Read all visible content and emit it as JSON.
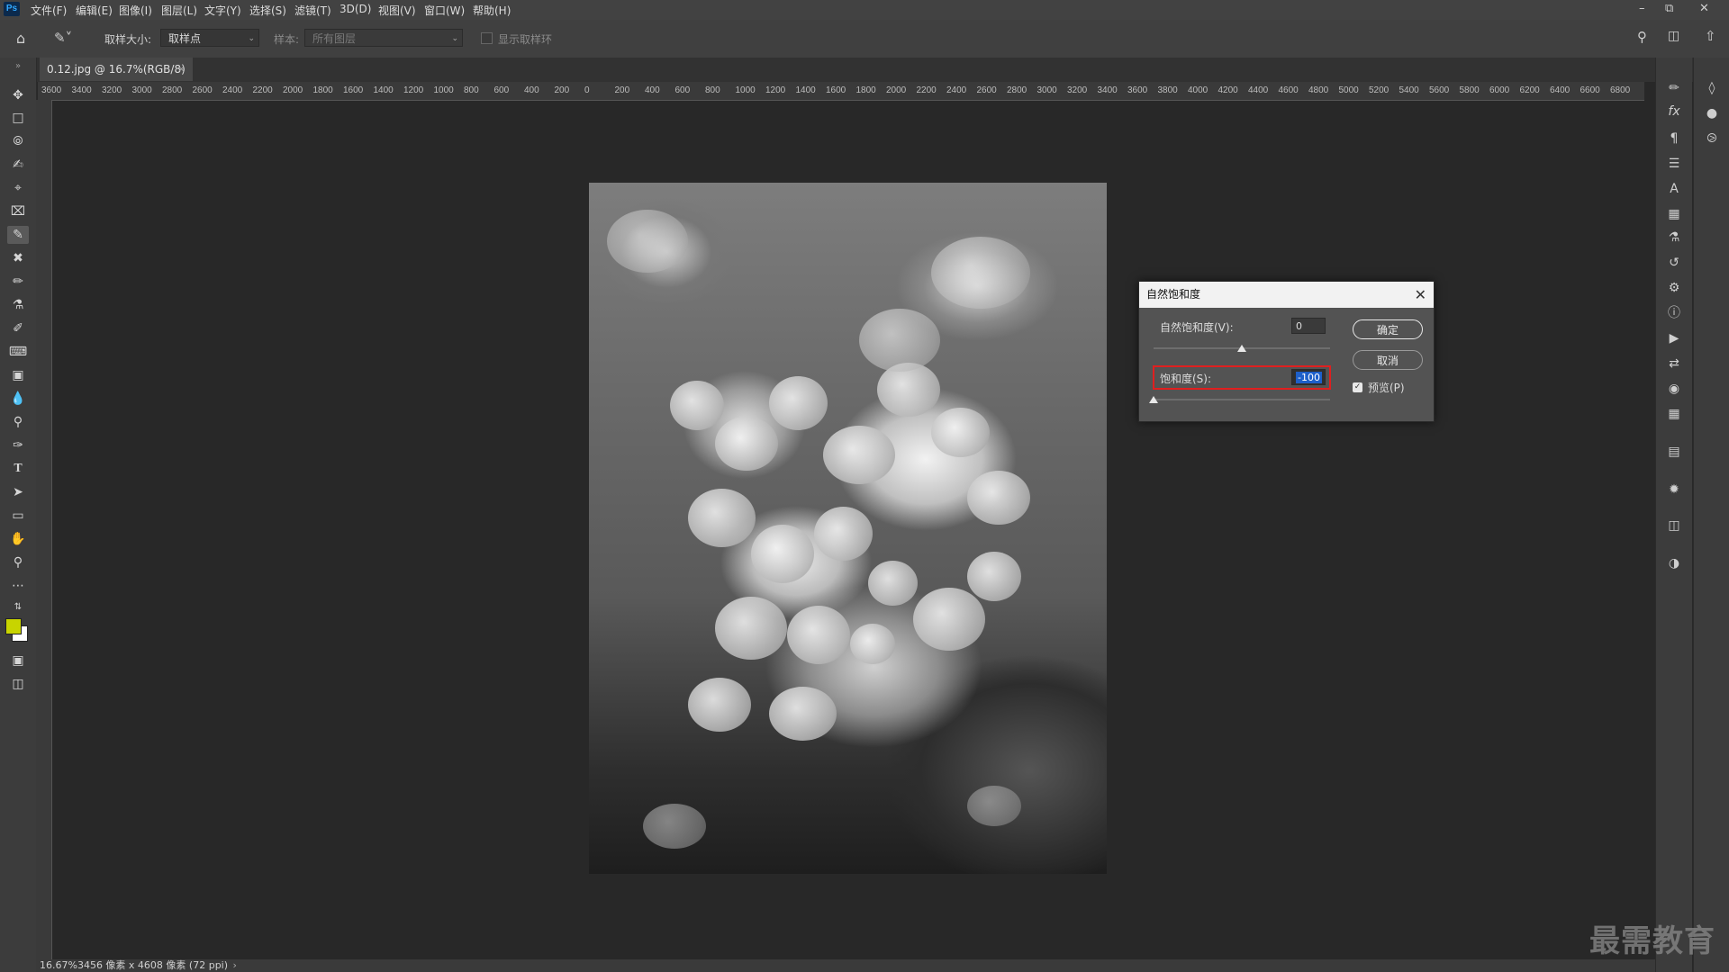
{
  "app": {
    "logo": "Ps"
  },
  "menu": [
    "文件(F)",
    "编辑(E)",
    "图像(I)",
    "图层(L)",
    "文字(Y)",
    "选择(S)",
    "滤镜(T)",
    "3D(D)",
    "视图(V)",
    "窗口(W)",
    "帮助(H)"
  ],
  "options": {
    "sample_size_label": "取样大小:",
    "sample_size_value": "取样点",
    "sample_label": "样本:",
    "sample_value": "所有图层",
    "show_ring_label": "显示取样环"
  },
  "document": {
    "tab_title": "0.12.jpg @ 16.7%(RGB/8)",
    "close": "×"
  },
  "ruler_top": [
    "3600",
    "3400",
    "3200",
    "3000",
    "2800",
    "2600",
    "2400",
    "2200",
    "2000",
    "1800",
    "1600",
    "1400",
    "1200",
    "1000",
    "800",
    "600",
    "400",
    "200",
    "0",
    "200",
    "400",
    "600",
    "800",
    "1000",
    "1200",
    "1400",
    "1600",
    "1800",
    "2000",
    "2200",
    "2400",
    "2600",
    "2800",
    "3000",
    "3200",
    "3400",
    "3600",
    "3800",
    "4000",
    "4200",
    "4400",
    "4600",
    "4800",
    "5000",
    "5200",
    "5400",
    "5600",
    "5800",
    "6000",
    "6200",
    "6400",
    "6600",
    "6800"
  ],
  "status": {
    "text": "16.67%3456 像素 x 4608 像素 (72 ppi)"
  },
  "dialog": {
    "title": "自然饱和度",
    "vibrance_label": "自然饱和度(V):",
    "vibrance_value": "0",
    "saturation_label": "饱和度(S):",
    "saturation_value": "-100",
    "ok_label": "确定",
    "cancel_label": "取消",
    "preview_label": "预览(P)",
    "preview_checked": true,
    "vibrance_slider_fraction": 0.5,
    "saturation_slider_fraction": 0.0
  },
  "colors": {
    "foreground": "#c8d400",
    "background": "#ffffff",
    "highlight": "#e01f1f"
  },
  "watermark": "最需教育"
}
